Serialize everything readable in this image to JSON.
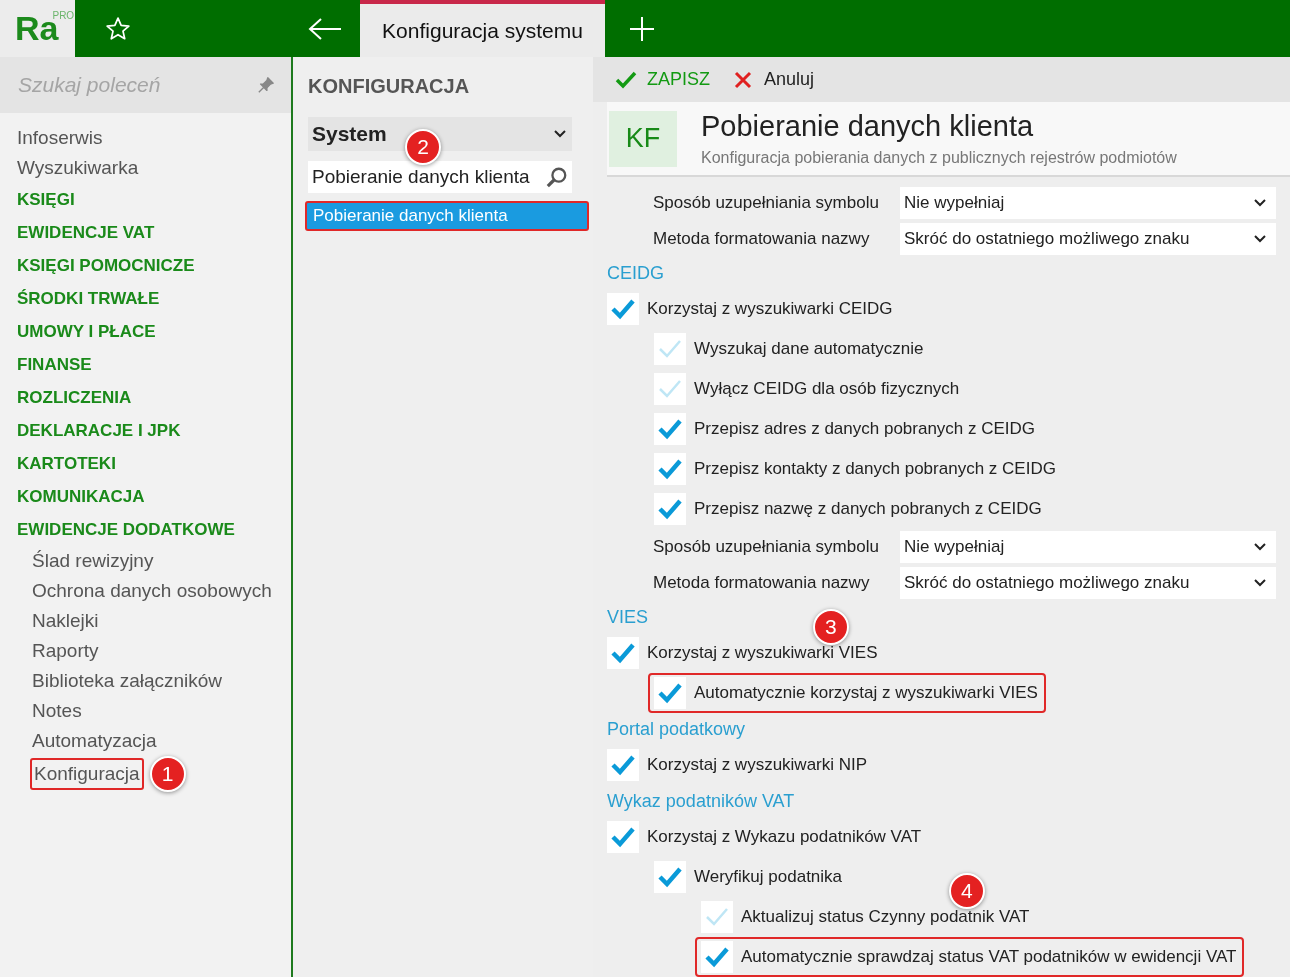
{
  "app": {
    "logo": "Ra",
    "logo_badge": "PRO"
  },
  "tabs": [
    {
      "label": "Konfiguracja systemu",
      "selected": true
    }
  ],
  "sidebar": {
    "search_placeholder": "Szukaj poleceń",
    "items": [
      {
        "label": "Infoserwis",
        "kind": "link",
        "selected": false
      },
      {
        "label": "Wyszukiwarka",
        "kind": "link",
        "selected": false
      },
      {
        "label": "KSIĘGI",
        "kind": "section",
        "selected": false
      },
      {
        "label": "EWIDENCJE VAT",
        "kind": "section",
        "selected": false
      },
      {
        "label": "KSIĘGI POMOCNICZE",
        "kind": "section",
        "selected": false
      },
      {
        "label": "ŚRODKI TRWAŁE",
        "kind": "section",
        "selected": false
      },
      {
        "label": "UMOWY I PŁACE",
        "kind": "section",
        "selected": false
      },
      {
        "label": "FINANSE",
        "kind": "section",
        "selected": false
      },
      {
        "label": "ROZLICZENIA",
        "kind": "section",
        "selected": false
      },
      {
        "label": "DEKLARACJE I JPK",
        "kind": "section",
        "selected": false
      },
      {
        "label": "KARTOTEKI",
        "kind": "section",
        "selected": false
      },
      {
        "label": "KOMUNIKACJA",
        "kind": "section",
        "selected": false
      },
      {
        "label": "EWIDENCJE DODATKOWE",
        "kind": "section",
        "selected": false,
        "children": [
          {
            "label": "Ślad rewizyjny",
            "selected": false
          },
          {
            "label": "Ochrona danych osobowych",
            "selected": false
          },
          {
            "label": "Naklejki",
            "selected": false
          },
          {
            "label": "Raporty",
            "selected": false
          },
          {
            "label": "Biblioteka załączników",
            "selected": false
          },
          {
            "label": "Notes",
            "selected": false
          },
          {
            "label": "Automatyzacja",
            "selected": false
          },
          {
            "label": "Konfiguracja",
            "selected": true,
            "callout": "1"
          }
        ]
      }
    ]
  },
  "middle": {
    "title": "KONFIGURACJA",
    "category": {
      "value": "System"
    },
    "search": {
      "value": "Pobieranie danych klienta",
      "callout": "2"
    },
    "results": [
      {
        "label": "Pobieranie danych klienta",
        "selected": true
      }
    ]
  },
  "toolbar": [
    {
      "label": "ZAPISZ",
      "kind": "save"
    },
    {
      "label": "Anuluj",
      "kind": "cancel"
    }
  ],
  "header": {
    "badge": "KF",
    "title": "Pobieranie danych klienta",
    "subtitle": "Konfiguracja pobierania danych z publicznych rejestrów podmiotów"
  },
  "sections": [
    {
      "items": [
        {
          "kind": "select",
          "label": "Sposób uzupełniania symbolu",
          "value": "Nie wypełniaj"
        },
        {
          "kind": "select",
          "label": "Metoda formatowania nazwy",
          "value": "Skróć do ostatniego możliwego znaku"
        }
      ]
    },
    {
      "title": "CEIDG",
      "items": [
        {
          "kind": "checkbox",
          "label": "Korzystaj z wyszukiwarki CEIDG",
          "checked": true,
          "children": [
            {
              "kind": "checkbox",
              "label": "Wyszukaj dane automatycznie",
              "checked": false
            },
            {
              "kind": "checkbox",
              "label": "Wyłącz CEIDG dla osób fizycznych",
              "checked": false
            },
            {
              "kind": "checkbox",
              "label": "Przepisz adres z danych pobranych z CEIDG",
              "checked": true
            },
            {
              "kind": "checkbox",
              "label": "Przepisz kontakty z danych pobranych z CEIDG",
              "checked": true
            },
            {
              "kind": "checkbox",
              "label": "Przepisz nazwę z danych pobranych z CEIDG",
              "checked": true
            }
          ]
        },
        {
          "kind": "select",
          "label": "Sposób uzupełniania symbolu",
          "value": "Nie wypełniaj"
        },
        {
          "kind": "select",
          "label": "Metoda formatowania nazwy",
          "value": "Skróć do ostatniego możliwego znaku"
        }
      ]
    },
    {
      "title": "VIES",
      "items": [
        {
          "kind": "checkbox",
          "label": "Korzystaj z wyszukiwarki VIES",
          "checked": true,
          "callout": "3",
          "children": [
            {
              "kind": "checkbox",
              "label": "Automatycznie korzystaj z wyszukiwarki VIES",
              "checked": true,
              "outlined": true
            }
          ]
        }
      ]
    },
    {
      "title": "Portal podatkowy",
      "items": [
        {
          "kind": "checkbox",
          "label": "Korzystaj z wyszukiwarki NIP",
          "checked": true
        }
      ]
    },
    {
      "title": "Wykaz podatników VAT",
      "items": [
        {
          "kind": "checkbox",
          "label": "Korzystaj z Wykazu podatników VAT",
          "checked": true,
          "children": [
            {
              "kind": "checkbox",
              "label": "Weryfikuj podatnika",
              "checked": true,
              "children": [
                {
                  "kind": "checkbox",
                  "label": "Aktualizuj status Czynny podatnik VAT",
                  "checked": false,
                  "callout": "4"
                },
                {
                  "kind": "checkbox",
                  "label": "Automatycznie sprawdzaj status VAT podatników w ewidencji VAT",
                  "checked": true,
                  "outlined": true
                }
              ]
            }
          ]
        }
      ]
    }
  ]
}
